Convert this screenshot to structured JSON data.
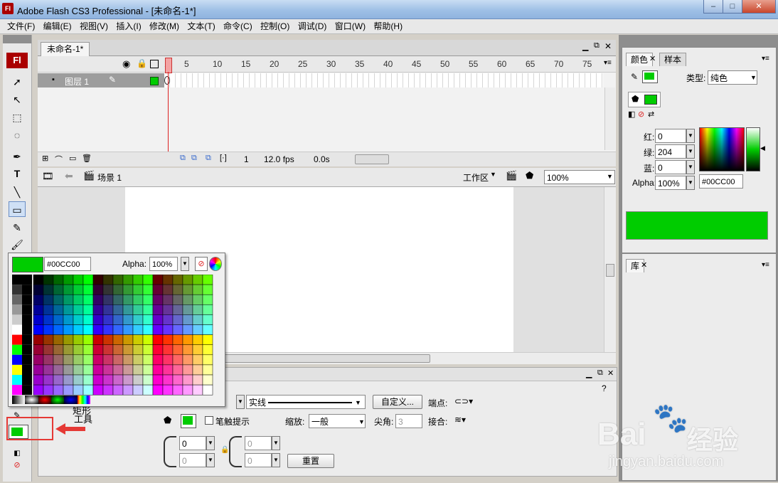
{
  "window": {
    "app_icon": "Fl",
    "title": "Adobe Flash CS3 Professional - [未命名-1*]",
    "minimize": "‒",
    "maximize": "□",
    "close": "✕"
  },
  "menu": [
    "文件(F)",
    "编辑(E)",
    "视图(V)",
    "插入(I)",
    "修改(M)",
    "文本(T)",
    "命令(C)",
    "控制(O)",
    "调试(D)",
    "窗口(W)",
    "帮助(H)"
  ],
  "tools": {
    "logo": "Fl"
  },
  "doc_tab": {
    "label": "未命名-1*"
  },
  "timeline": {
    "frame_numbers": [
      "1",
      "5",
      "10",
      "15",
      "20",
      "25",
      "30",
      "35",
      "40",
      "45",
      "50",
      "55",
      "60",
      "65",
      "70",
      "75"
    ],
    "layer_name": "图层 1",
    "current_frame": "1",
    "fps": "12.0 fps",
    "time": "0.0s"
  },
  "edit_bar": {
    "scene": "场景 1",
    "workspace": "工作区",
    "zoom": "100%"
  },
  "properties": {
    "stroke_style": "实线",
    "custom_button": "自定义...",
    "cap_label": "端点:",
    "stroke_hint_label": "笔触提示",
    "scale_label": "缩放:",
    "scale_value": "一般",
    "miter_label": "尖角:",
    "miter_value": "3",
    "join_label": "接合:",
    "tool_label": "工具",
    "rect_label": "矩形",
    "corner_values": [
      "0",
      "0",
      "0",
      "0"
    ],
    "reset_button": "重置",
    "help": "?"
  },
  "color_panel": {
    "tabs": [
      "颜色",
      "样本"
    ],
    "type_label": "类型:",
    "type_value": "纯色",
    "r_label": "红:",
    "r_value": "0",
    "g_label": "绿:",
    "g_value": "204",
    "b_label": "蓝:",
    "b_value": "0",
    "alpha_label": "Alpha:",
    "alpha_value": "100%",
    "hex": "#00CC00"
  },
  "library_panel": {
    "tab": "库"
  },
  "swatch_popup": {
    "hex": "#00CC00",
    "alpha_label": "Alpha:",
    "alpha_value": "100%"
  },
  "colors": {
    "current_fill": "#00CC00",
    "accent_red": "#e53935"
  },
  "watermark": {
    "brand": "Bai",
    "brand_cn": "经验",
    "url": "jingyan.baidu.com"
  }
}
